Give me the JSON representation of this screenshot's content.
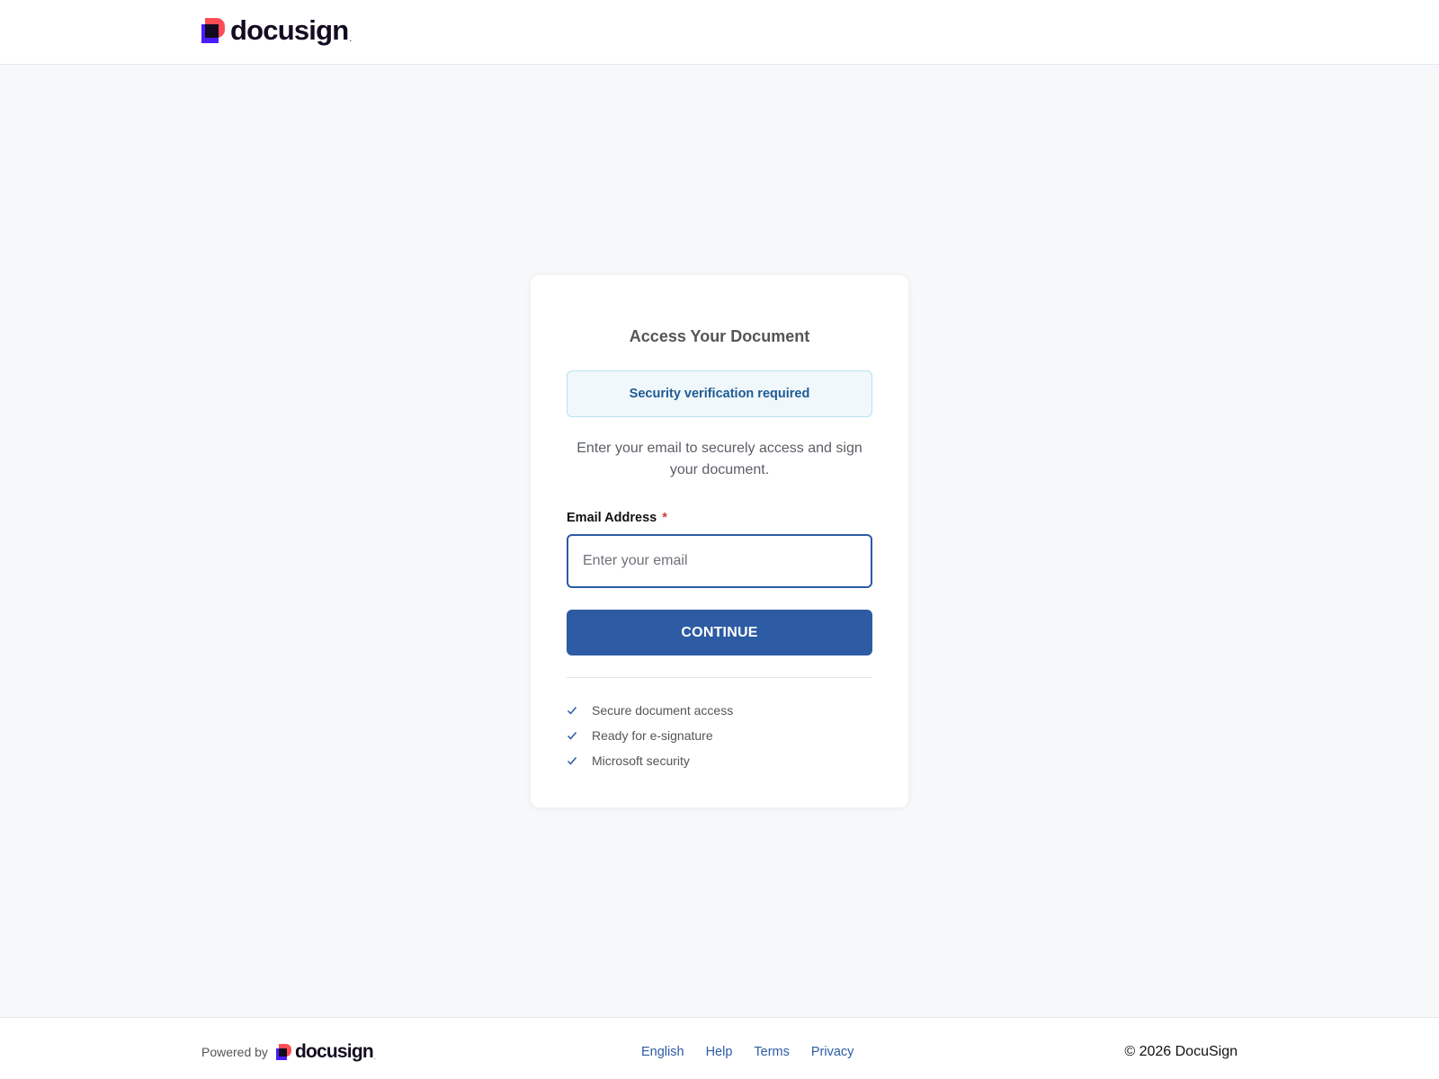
{
  "header": {
    "logo_text": "docusign",
    "logo_dot": "."
  },
  "card": {
    "title": "Access Your Document",
    "alert": "Security verification required",
    "description": "Enter your email to securely access and sign your document.",
    "email_label": "Email Address",
    "required_marker": "*",
    "email_placeholder": "Enter your email",
    "email_value": "",
    "continue_label": "CONTINUE",
    "features": [
      {
        "label": "Secure document access",
        "icon": "check-icon"
      },
      {
        "label": "Ready for e-signature",
        "icon": "check-icon"
      },
      {
        "label": "Microsoft security",
        "icon": "check-icon"
      }
    ]
  },
  "footer": {
    "powered_by": "Powered by",
    "logo_text": "docusign",
    "logo_dot": ".",
    "links": [
      "English",
      "Help",
      "Terms",
      "Privacy"
    ],
    "copyright": "© 2026 DocuSign"
  },
  "colors": {
    "brand_red": "#ff4d55",
    "brand_purple": "#4b1cff",
    "primary": "#2d5ba4",
    "alert_bg": "#f0f8fc",
    "page_bg": "#f7f8fa"
  }
}
